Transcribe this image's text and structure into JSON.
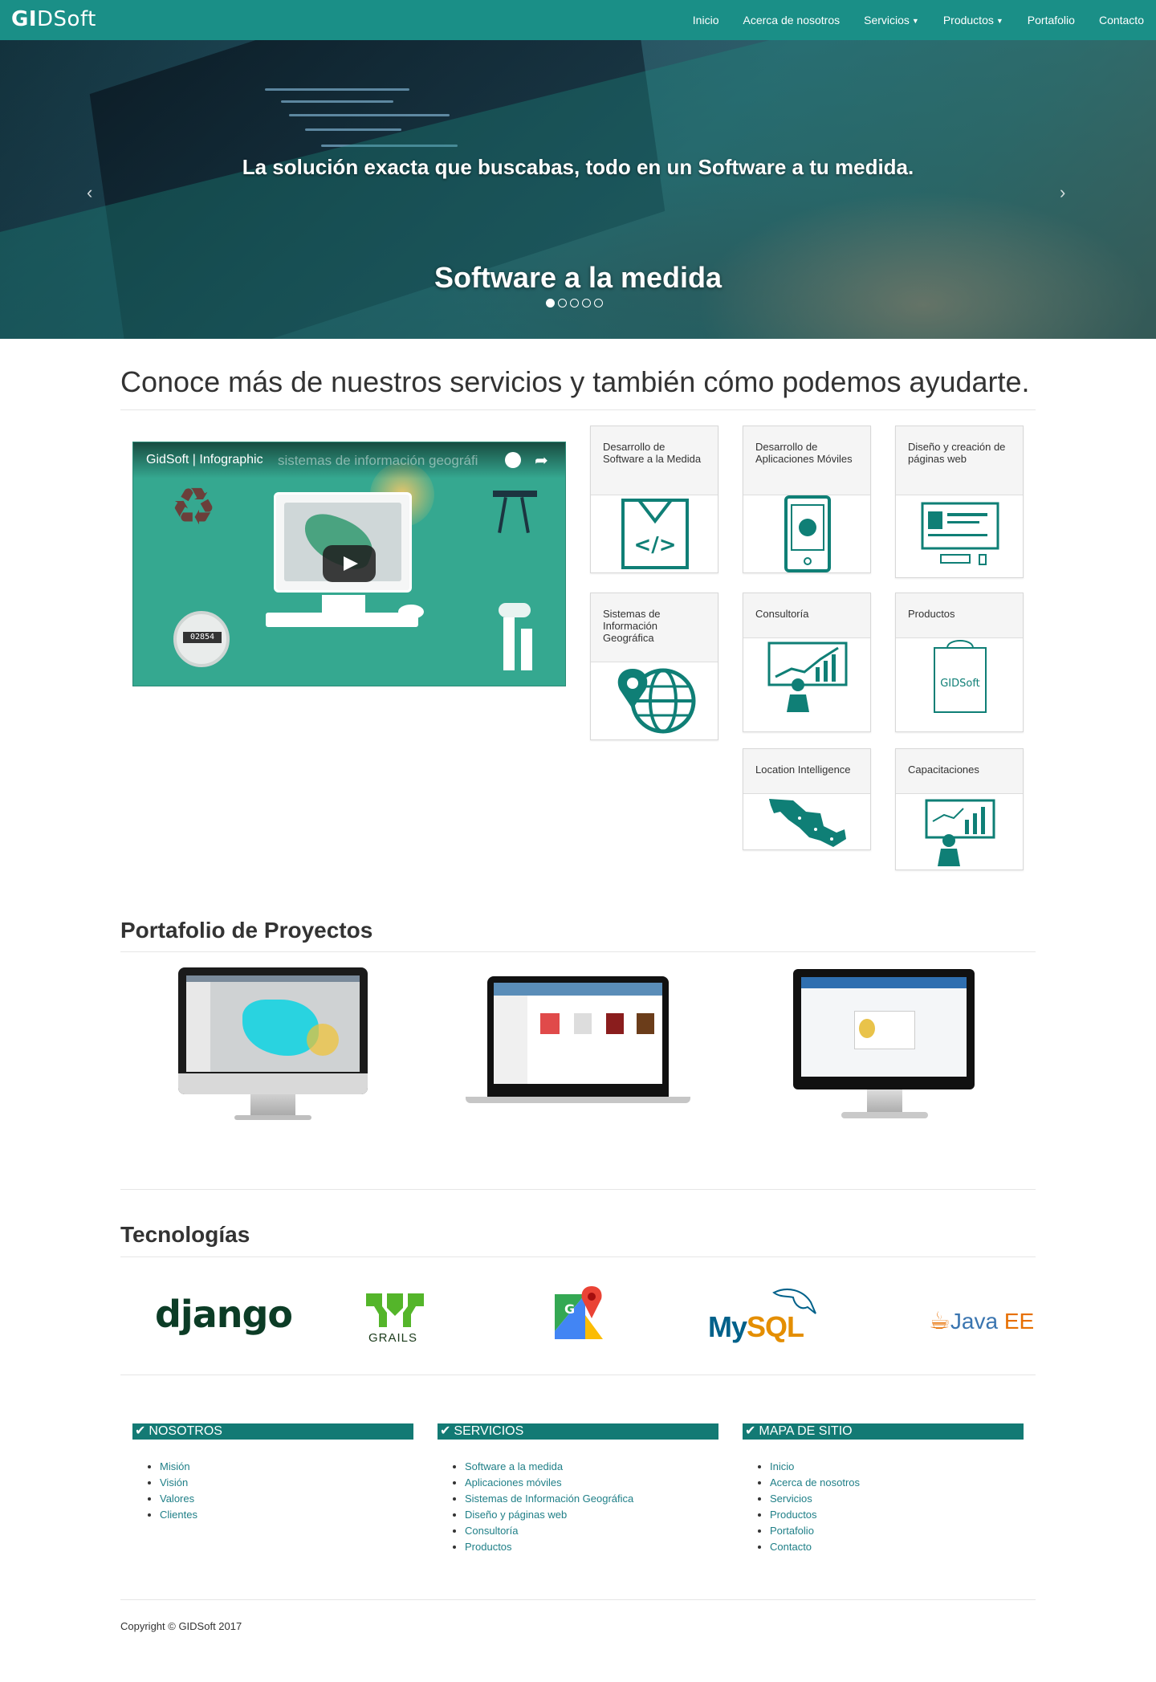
{
  "navbar": {
    "brand": "GIDSoft",
    "items": [
      {
        "label": "Inicio"
      },
      {
        "label": "Acerca de nosotros"
      },
      {
        "label": "Servicios"
      },
      {
        "label": "Productos"
      },
      {
        "label": "Portafolio"
      },
      {
        "label": "Contacto"
      }
    ]
  },
  "hero": {
    "caption_top": "La solución exacta que buscabas, todo en un Software a tu medida.",
    "caption_main": "Software a la medida",
    "prev_arrow": "‹",
    "next_arrow": "›",
    "slides_total": 5,
    "active_slide": 1
  },
  "services": {
    "heading": "Conoce más de nuestros servicios y también cómo podemos ayudarte.",
    "video": {
      "title": "GidSoft | Infographic",
      "ghost_title": "sistemas de información geográfi",
      "meter_value": "02854"
    },
    "cards": [
      {
        "label": "Desarrollo de Software a la Medida",
        "icon": "code-file-icon"
      },
      {
        "label": "Desarrollo de Aplicaciones Móviles",
        "icon": "mobile-gear-icon"
      },
      {
        "label": "Diseño y creación de páginas web",
        "icon": "web-page-icon"
      },
      {
        "label": "Sistemas de Información Geográfica",
        "icon": "globe-pin-icon"
      },
      {
        "label": "Consultoría",
        "icon": "presentation-chart-icon"
      },
      {
        "label": "Productos",
        "icon": "shopping-bag-icon",
        "bag_text": "GIDSoft"
      },
      {
        "label": "Location Intelligence",
        "icon": "mexico-map-icon"
      },
      {
        "label": "Capacitaciones",
        "icon": "training-board-icon"
      }
    ]
  },
  "portfolio": {
    "heading": "Portafolio de Proyectos"
  },
  "technologies": {
    "heading": "Tecnologías",
    "logos": [
      {
        "name": "django",
        "text": "django"
      },
      {
        "name": "grails",
        "text": "GRAILS"
      },
      {
        "name": "google-maps",
        "text": ""
      },
      {
        "name": "mysql",
        "text_a": "My",
        "text_b": "SQL"
      },
      {
        "name": "java-ee",
        "text_a": "Java ",
        "text_b": "EE"
      }
    ]
  },
  "footer": {
    "columns": [
      {
        "title": "NOSOTROS",
        "items": [
          "Misión",
          "Visión",
          "Valores",
          "Clientes"
        ]
      },
      {
        "title": "SERVICIOS",
        "items": [
          "Software a la medida",
          "Aplicaciones móviles",
          "Sistemas de Información Geográfica",
          "Diseño y páginas web",
          "Consultoría",
          "Productos"
        ]
      },
      {
        "title": "MAPA DE SITIO",
        "items": [
          "Inicio",
          "Acerca de nosotros",
          "Servicios",
          "Productos",
          "Portafolio",
          "Contacto"
        ]
      }
    ],
    "copyright": "Copyright © GIDSoft 2017"
  },
  "colors": {
    "primary": "#1a8f87",
    "footer_head": "#137a74",
    "link": "#1f7f87",
    "icon": "#0f7f76"
  }
}
